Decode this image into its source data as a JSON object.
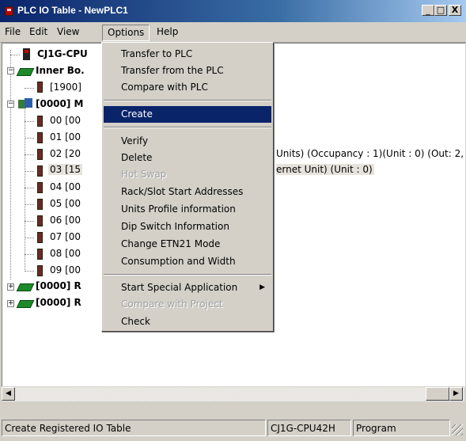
{
  "window": {
    "title": "PLC IO Table - NewPLC1",
    "min_label": "_",
    "max_label": "□",
    "close_label": "X"
  },
  "menubar": [
    "File",
    "Edit",
    "View",
    "Options",
    "Help"
  ],
  "tree": {
    "root": "CJ1G-CPU",
    "inner_board": "Inner Bo.",
    "inner_child": "[1900]",
    "main_rack": "[0000] M",
    "slots": [
      "00 [00",
      "01 [00",
      "02 [20",
      "03 [15",
      "04 [00",
      "05 [00",
      "06 [00",
      "07 [00",
      "08 [00",
      "09 [00"
    ],
    "slot02_detail": "Units) (Occupancy : 1)(Unit : 0) (Out: 2,",
    "slot03_detail": "ernet Unit) (Unit : 0)",
    "racks": [
      "[0000] R",
      "[0000] R"
    ]
  },
  "options_menu": {
    "items": [
      {
        "label": "Transfer to PLC",
        "enabled": true
      },
      {
        "label": "Transfer from the PLC",
        "enabled": true
      },
      {
        "label": "Compare with PLC",
        "enabled": true
      },
      {
        "label": "Create",
        "enabled": true,
        "highlighted": true
      },
      {
        "label": "Verify",
        "enabled": true
      },
      {
        "label": "Delete",
        "enabled": true
      },
      {
        "label": "Hot Swap",
        "enabled": false
      },
      {
        "label": "Rack/Slot Start Addresses",
        "enabled": true
      },
      {
        "label": "Units Profile information",
        "enabled": true
      },
      {
        "label": "Dip Switch Information",
        "enabled": true
      },
      {
        "label": "Change ETN21 Mode",
        "enabled": true
      },
      {
        "label": "Consumption and Width",
        "enabled": true
      },
      {
        "label": "Start Special Application",
        "enabled": true,
        "submenu": true
      },
      {
        "label": "Compare with Project",
        "enabled": false
      },
      {
        "label": "Check",
        "enabled": true
      }
    ]
  },
  "statusbar": {
    "message": "Create Registered IO Table",
    "cpu": "CJ1G-CPU42H",
    "mode": "Program"
  }
}
